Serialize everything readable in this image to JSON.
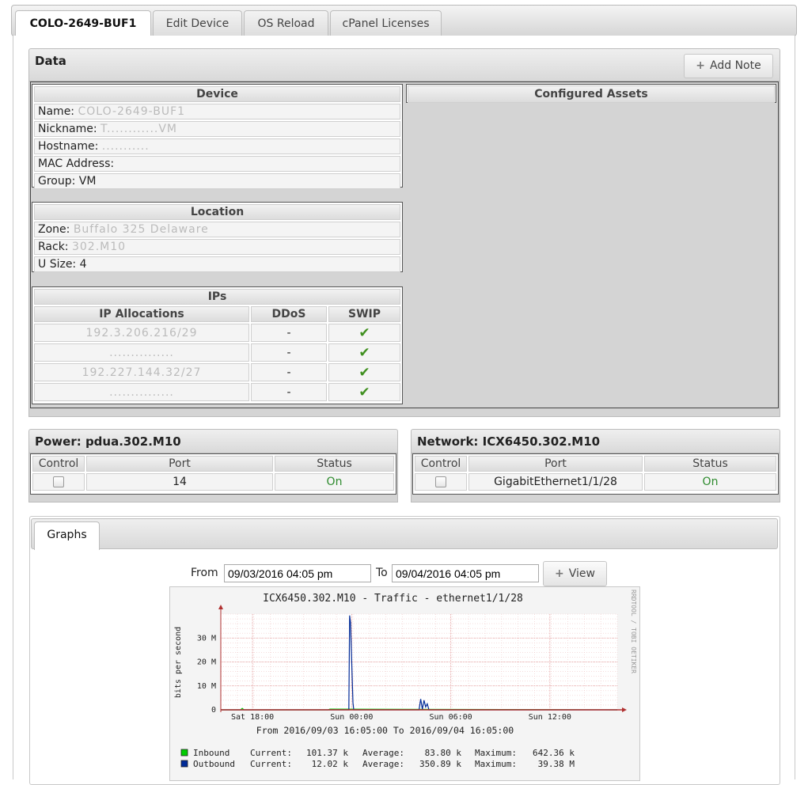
{
  "tabs": [
    {
      "label": "COLO-2649-BUF1"
    },
    {
      "label": "Edit Device"
    },
    {
      "label": "OS Reload"
    },
    {
      "label": "cPanel Licenses"
    }
  ],
  "data_panel": {
    "title": "Data",
    "add_note_label": "Add Note",
    "device": {
      "title": "Device",
      "name_label": "Name:",
      "name_value": "COLO-2649-BUF1",
      "nickname_label": "Nickname:",
      "nickname_value": "T............VM",
      "hostname_label": "Hostname:",
      "hostname_value": "...........",
      "mac_label": "MAC Address:",
      "group_label": "Group:",
      "group_value": "VM"
    },
    "configured_assets_title": "Configured Assets",
    "location": {
      "title": "Location",
      "zone_label": "Zone:",
      "zone_value": "Buffalo 325 Delaware",
      "rack_label": "Rack:",
      "rack_value": "302.M10",
      "usize_label": "U Size:",
      "usize_value": "4"
    },
    "ips": {
      "title": "IPs",
      "headers": [
        "IP Allocations",
        "DDoS",
        "SWIP"
      ],
      "rows": [
        {
          "ip": "192.3.206.216/29",
          "ddos": "-"
        },
        {
          "ip": "...............",
          "ddos": "-"
        },
        {
          "ip": "192.227.144.32/27",
          "ddos": "-"
        },
        {
          "ip": "...............",
          "ddos": "-"
        }
      ]
    }
  },
  "power": {
    "title": "Power: pdua.302.M10",
    "headers": [
      "Control",
      "Port",
      "Status"
    ],
    "port": "14",
    "status": "On"
  },
  "network": {
    "title": "Network: ICX6450.302.M10",
    "headers": [
      "Control",
      "Port",
      "Status"
    ],
    "port": "GigabitEthernet1/1/28",
    "status": "On"
  },
  "graphs": {
    "tab_label": "Graphs",
    "from_label": "From",
    "from_value": "09/03/2016 04:05 pm",
    "to_label": "To",
    "to_value": "09/04/2016 04:05 pm",
    "view_label": "View"
  },
  "chart_data": {
    "type": "line",
    "title": "ICX6450.302.M10 - Traffic - ethernet1/1/28",
    "ylabel": "bits per second",
    "subtitle": "From 2016/09/03 16:05:00 To 2016/09/04 16:05:00",
    "watermark": "RRDTOOL / TOBI OETIKER",
    "ylim": [
      0,
      40
    ],
    "yticks": [
      0,
      10,
      20,
      30
    ],
    "ytick_labels": [
      "0",
      "10 M",
      "20 M",
      "30 M"
    ],
    "xlim_hours": [
      0,
      24
    ],
    "xticks_hours": [
      1.92,
      7.92,
      13.92,
      19.92
    ],
    "xtick_labels": [
      "Sat 18:00",
      "Sun 00:00",
      "Sun 06:00",
      "Sun 12:00"
    ],
    "colors": {
      "inbound": "#00cc00",
      "outbound": "#002a97",
      "axis": "#b03030"
    },
    "series": [
      {
        "name": "Inbound",
        "x": [
          0,
          1.2,
          1.3,
          1.4,
          6.5,
          6.6,
          24
        ],
        "y": [
          0,
          0,
          0.6,
          0,
          0,
          0.3,
          0
        ],
        "current": "101.37 k",
        "average": "83.80 k",
        "maximum": "642.36 k"
      },
      {
        "name": "Outbound",
        "x": [
          0,
          7.75,
          7.8,
          7.85,
          8.0,
          8.05,
          8.1,
          12.0,
          12.1,
          12.2,
          12.3,
          12.4,
          12.5,
          12.6,
          24
        ],
        "y": [
          0,
          0,
          39.4,
          36.5,
          3,
          0,
          0,
          0,
          4.5,
          0.2,
          4.0,
          1.2,
          2.5,
          0,
          0
        ],
        "current": "12.02 k",
        "average": "350.89 k",
        "maximum": "39.38 M"
      }
    ],
    "legend_labels": {
      "current": "Current:",
      "average": "Average:",
      "maximum": "Maximum:"
    }
  }
}
